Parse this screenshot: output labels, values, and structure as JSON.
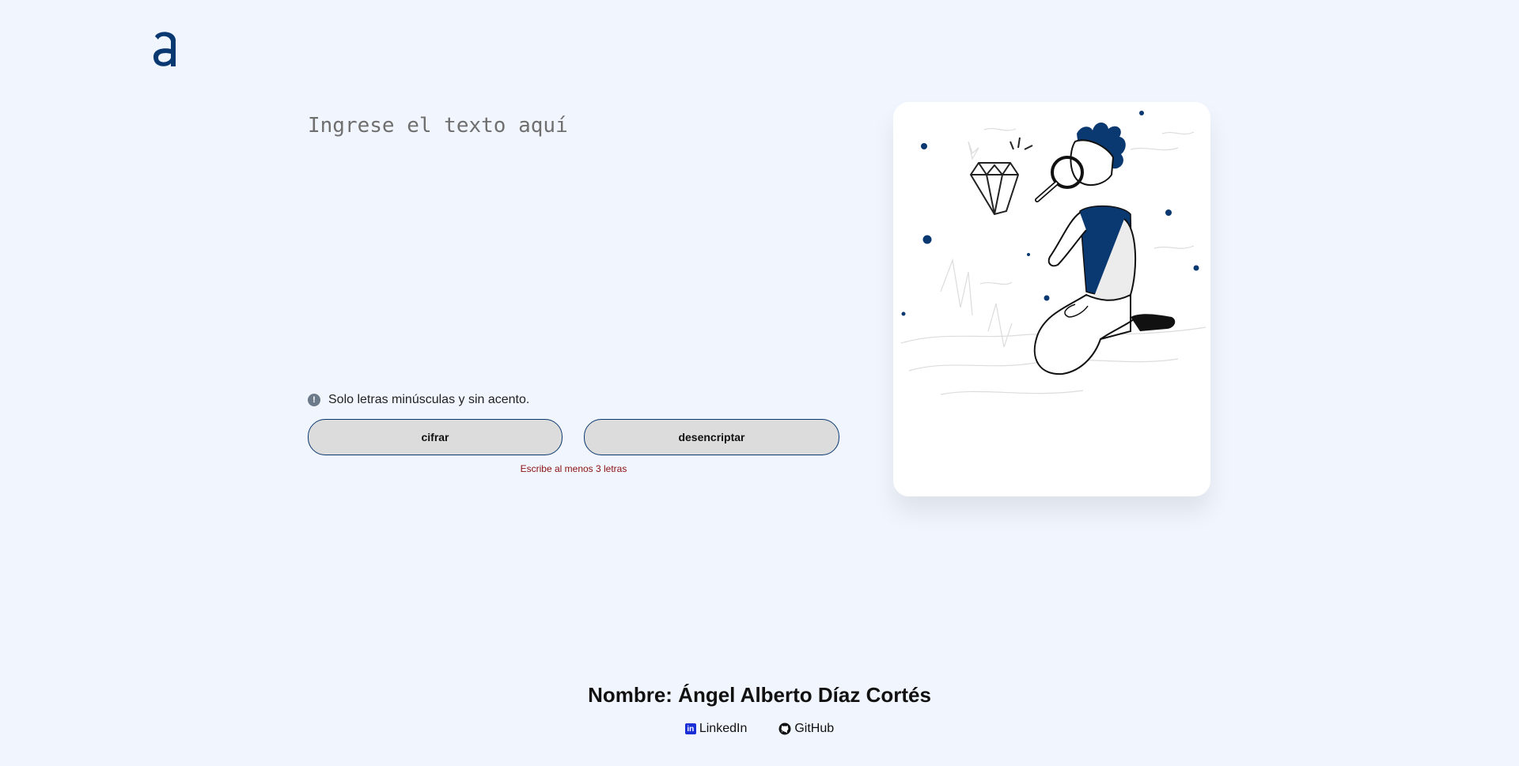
{
  "brand": {
    "logo_letter": "a",
    "accent_color": "#0a3871"
  },
  "editor": {
    "placeholder": "Ingrese el texto aquí",
    "value": ""
  },
  "hint": {
    "icon": "exclamation-circle-icon",
    "text": "Solo letras minúsculas y sin acento."
  },
  "actions": {
    "encrypt_label": "cifrar",
    "decrypt_label": "desencriptar"
  },
  "validation": {
    "error_text": "Escribe al menos 3 letras",
    "error_color": "#8a1010"
  },
  "illustration": {
    "subject": "person-kneeling-with-magnifying-glass-looking-at-diamond"
  },
  "footer": {
    "name": "Nombre: Ángel Alberto Díaz Cortés",
    "links": [
      {
        "label": "LinkedIn",
        "icon": "linkedin-icon"
      },
      {
        "label": "GitHub",
        "icon": "github-icon"
      }
    ]
  }
}
